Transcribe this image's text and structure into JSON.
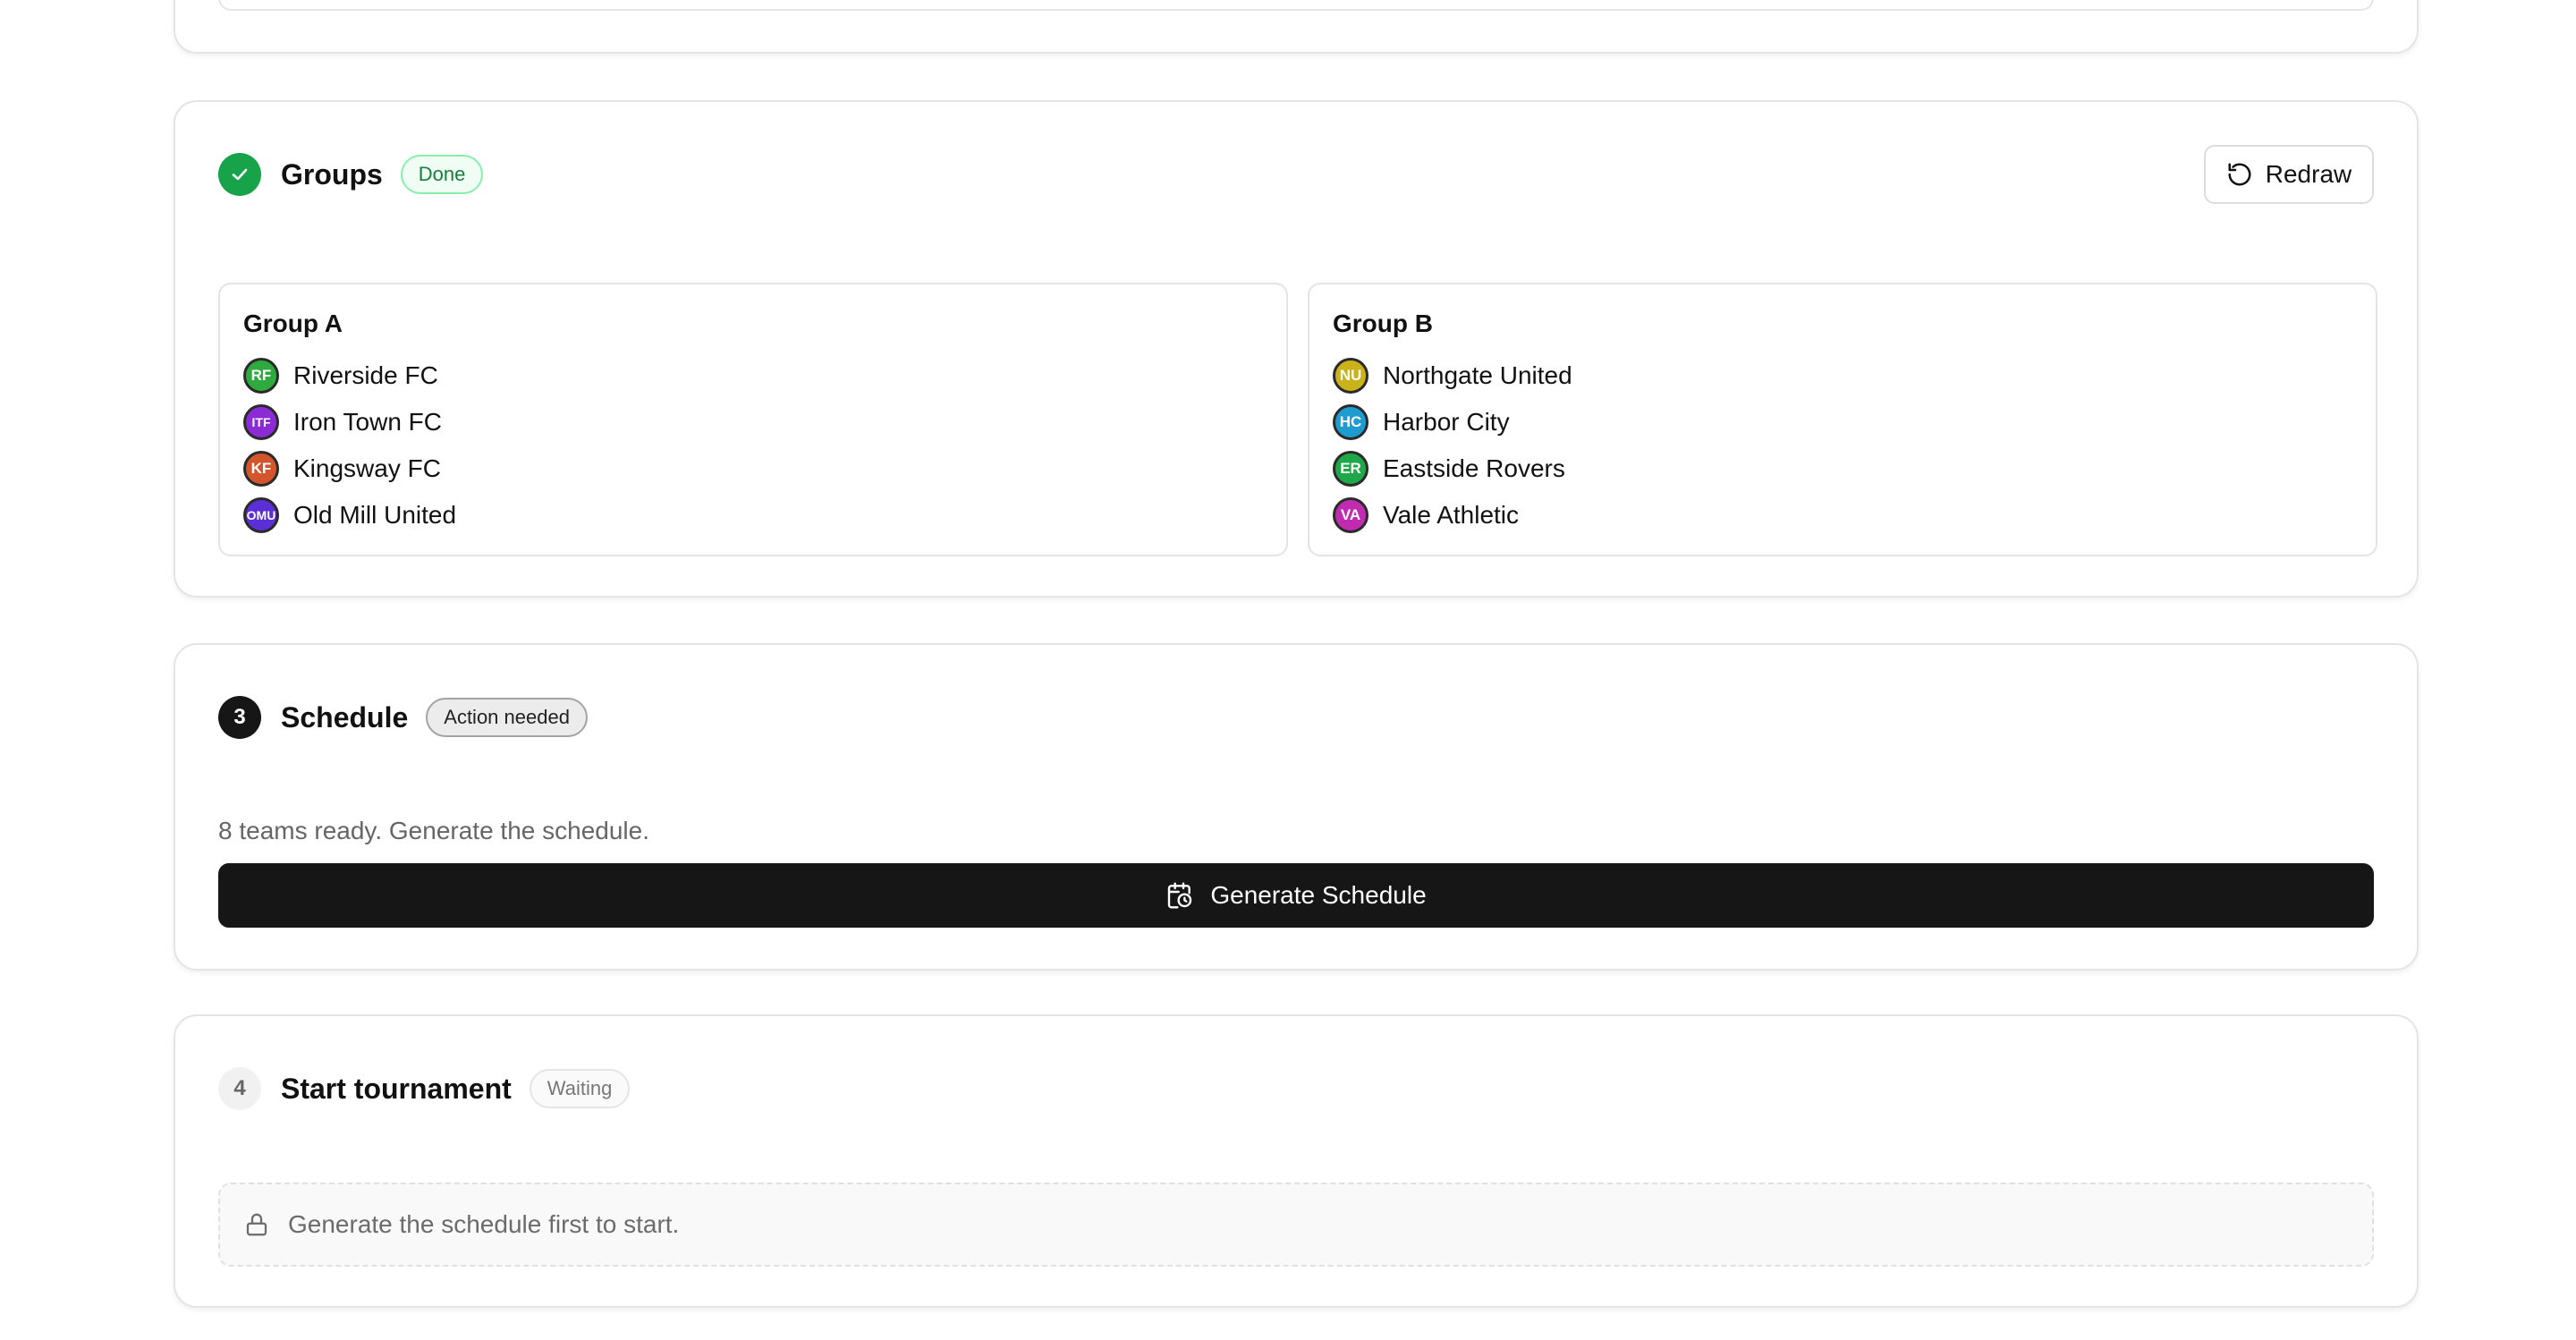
{
  "steps": {
    "groups": {
      "title": "Groups",
      "badge": "Done",
      "redraw_label": "Redraw",
      "groups": [
        {
          "title": "Group A",
          "teams": [
            {
              "initials": "RF",
              "name": "Riverside FC",
              "color": "#2eaa3e"
            },
            {
              "initials": "ITF",
              "name": "Iron Town FC",
              "color": "#8a2bd6"
            },
            {
              "initials": "KF",
              "name": "Kingsway FC",
              "color": "#d2552b"
            },
            {
              "initials": "OMU",
              "name": "Old Mill United",
              "color": "#5b2ed6"
            }
          ]
        },
        {
          "title": "Group B",
          "teams": [
            {
              "initials": "NU",
              "name": "Northgate United",
              "color": "#c9b21a"
            },
            {
              "initials": "HC",
              "name": "Harbor City",
              "color": "#1e9ccf"
            },
            {
              "initials": "ER",
              "name": "Eastside Rovers",
              "color": "#1fa84a"
            },
            {
              "initials": "VA",
              "name": "Vale Athletic",
              "color": "#c02bb0"
            }
          ]
        }
      ]
    },
    "schedule": {
      "number": "3",
      "title": "Schedule",
      "badge": "Action needed",
      "description": "8 teams ready. Generate the schedule.",
      "button_label": "Generate Schedule"
    },
    "start": {
      "number": "4",
      "title": "Start tournament",
      "badge": "Waiting",
      "locked_message": "Generate the schedule first to start."
    }
  },
  "icons": {
    "done": "check-icon",
    "redraw": "rotate-ccw-icon",
    "generate": "calendar-clock-icon",
    "locked": "lock-icon"
  },
  "colors": {
    "success": "#16a34a",
    "primary": "#161616"
  }
}
